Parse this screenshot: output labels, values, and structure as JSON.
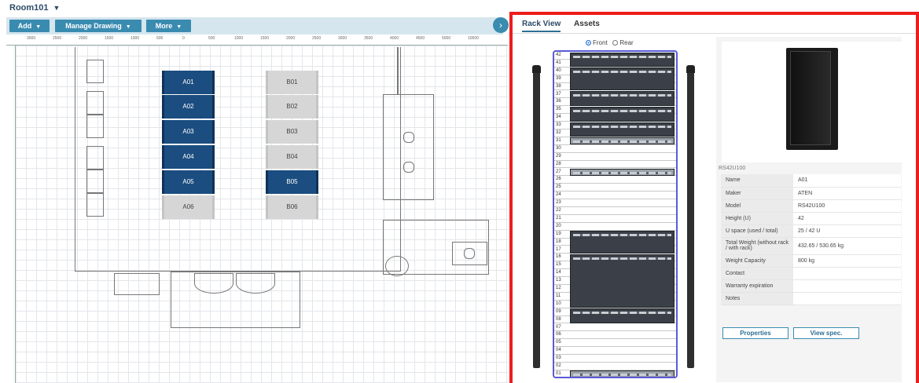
{
  "room": {
    "title": "Room101"
  },
  "toolbar": {
    "add_label": "Add",
    "manage_label": "Manage Drawing",
    "more_label": "More",
    "collapse_glyph": "›",
    "accent": "#3a8bb0"
  },
  "ruler": {
    "ticks": [
      "3000",
      "2500",
      "2000",
      "1500",
      "1000",
      "500",
      "0",
      "500",
      "1000",
      "1500",
      "2000",
      "2500",
      "3000",
      "3500",
      "4000",
      "4500",
      "5000",
      "10500"
    ]
  },
  "floor": {
    "racks": [
      {
        "label": "A01",
        "state": "active"
      },
      {
        "label": "A02",
        "state": "active"
      },
      {
        "label": "A03",
        "state": "active"
      },
      {
        "label": "A04",
        "state": "active"
      },
      {
        "label": "A05",
        "state": "active"
      },
      {
        "label": "A06",
        "state": "idle"
      },
      {
        "label": "B01",
        "state": "idle"
      },
      {
        "label": "B02",
        "state": "idle"
      },
      {
        "label": "B03",
        "state": "idle"
      },
      {
        "label": "B04",
        "state": "idle"
      },
      {
        "label": "B05",
        "state": "active"
      },
      {
        "label": "B06",
        "state": "idle"
      }
    ]
  },
  "panel": {
    "tabs": [
      "Rack View",
      "Assets"
    ],
    "view_options": {
      "front": "Front",
      "rear": "Rear",
      "selected": "Front"
    },
    "units": [
      "42",
      "41",
      "40",
      "39",
      "38",
      "37",
      "36",
      "35",
      "34",
      "33",
      "32",
      "31",
      "30",
      "29",
      "28",
      "27",
      "26",
      "25",
      "24",
      "23",
      "22",
      "21",
      "20",
      "19",
      "18",
      "17",
      "16",
      "15",
      "14",
      "13",
      "12",
      "11",
      "10",
      "09",
      "08",
      "07",
      "06",
      "05",
      "04",
      "03",
      "02",
      "01"
    ],
    "model_caption": "RS42U100",
    "properties": [
      {
        "key": "Name",
        "value": "A01"
      },
      {
        "key": "Maker",
        "value": "ATEN"
      },
      {
        "key": "Model",
        "value": "RS42U100"
      },
      {
        "key": "Height (U)",
        "value": "42"
      },
      {
        "key": "U space (used / total)",
        "value": "25 / 42 U"
      },
      {
        "key": "Total Weight (without rack / with rack)",
        "value": "432.65 / 530.65 kg"
      },
      {
        "key": "Weight Capacity",
        "value": "800 kg"
      },
      {
        "key": "Contact",
        "value": ""
      },
      {
        "key": "Warranty expiration",
        "value": ""
      },
      {
        "key": "Notes",
        "value": ""
      }
    ],
    "properties_btn": "Properties",
    "view_spec_btn": "View spec."
  },
  "colors": {
    "highlight_border": "#ee1c1c",
    "rack_active": "#1b4d80",
    "rack_idle": "#d6d6d6"
  }
}
